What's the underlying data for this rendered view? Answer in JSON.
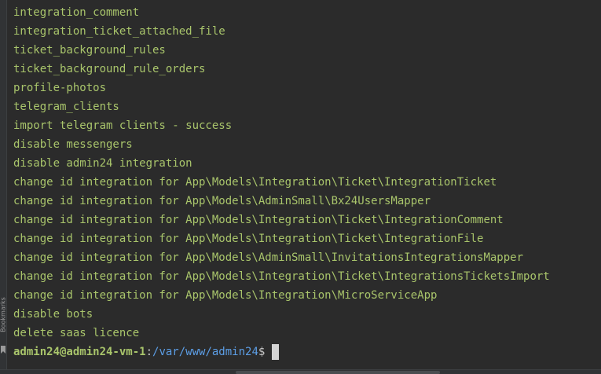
{
  "sidebar": {
    "bookmarks_label": "Bookmarks",
    "bookmarks_icon": "bookmark-icon"
  },
  "terminal": {
    "text_color": "#a9c56b",
    "path_color": "#5c9ee6",
    "background": "#2b2b2b",
    "lines": [
      "integration_comment",
      "integration_ticket_attached_file",
      "ticket_background_rules",
      "ticket_background_rule_orders",
      "profile-photos",
      "telegram_clients",
      "import telegram clients - success",
      "disable messengers",
      "disable admin24 integration",
      "change id integration for App\\Models\\Integration\\Ticket\\IntegrationTicket",
      "change id integration for App\\Models\\AdminSmall\\Bx24UsersMapper",
      "change id integration for App\\Models\\Integration\\Ticket\\IntegrationComment",
      "change id integration for App\\Models\\Integration\\Ticket\\IntegrationFile",
      "change id integration for App\\Models\\AdminSmall\\InvitationsIntegrationsMapper",
      "change id integration for App\\Models\\Integration\\Ticket\\IntegrationsTicketsImport",
      "change id integration for App\\Models\\Integration\\MicroServiceApp",
      "disable bots",
      "delete saas licence"
    ],
    "prompt": {
      "user_host": "admin24@admin24-vm-1",
      "separator": ":",
      "path": "/var/www/admin24",
      "symbol": "$"
    }
  }
}
